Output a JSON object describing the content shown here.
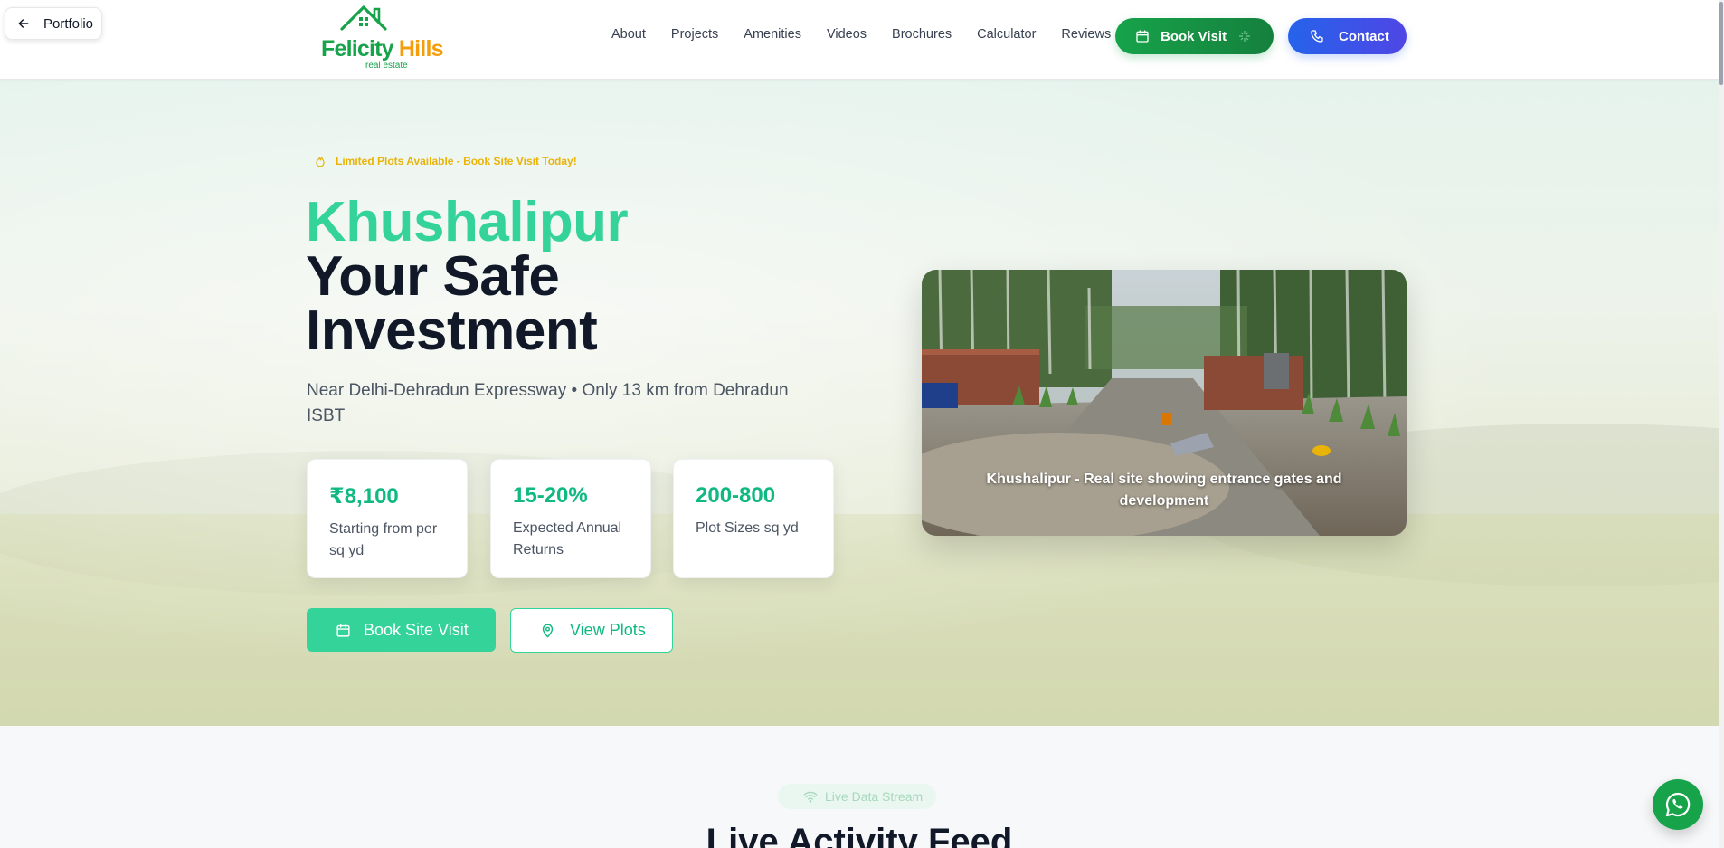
{
  "portfolio": {
    "label": "Portfolio"
  },
  "logo": {
    "name_part1": "Felicity",
    "name_part2": "Hills",
    "tagline": "real estate"
  },
  "nav": {
    "items": [
      {
        "label": "About"
      },
      {
        "label": "Projects"
      },
      {
        "label": "Amenities"
      },
      {
        "label": "Videos"
      },
      {
        "label": "Brochures"
      },
      {
        "label": "Calculator"
      },
      {
        "label": "Reviews"
      }
    ]
  },
  "header_buttons": {
    "book_visit": "Book Visit",
    "contact": "Contact"
  },
  "hero": {
    "badge": "Limited Plots Available - Book Site Visit Today!",
    "title_line1": "Khushalipur",
    "title_line2": "Your Safe",
    "title_line3": "Investment",
    "subtitle": "Near Delhi-Dehradun Expressway • Only 13 km from Dehradun ISBT",
    "stats": [
      {
        "value": "₹8,100",
        "label": "Starting from per sq yd"
      },
      {
        "value": "15-20%",
        "label": "Expected Annual Returns"
      },
      {
        "value": "200-800",
        "label": "Plot Sizes sq yd"
      }
    ],
    "cta_primary": "Book Site Visit",
    "cta_secondary": "View Plots",
    "photo_caption": "Khushalipur - Real site showing entrance gates and development"
  },
  "live_section": {
    "pill": "Live Data Stream",
    "title": "Live Activity Feed"
  },
  "colors": {
    "brand_green": "#16a34a",
    "accent_emerald": "#34d399",
    "contact_blue": "#2563eb",
    "badge_yellow": "#eab308",
    "heading_dark": "#111827"
  }
}
